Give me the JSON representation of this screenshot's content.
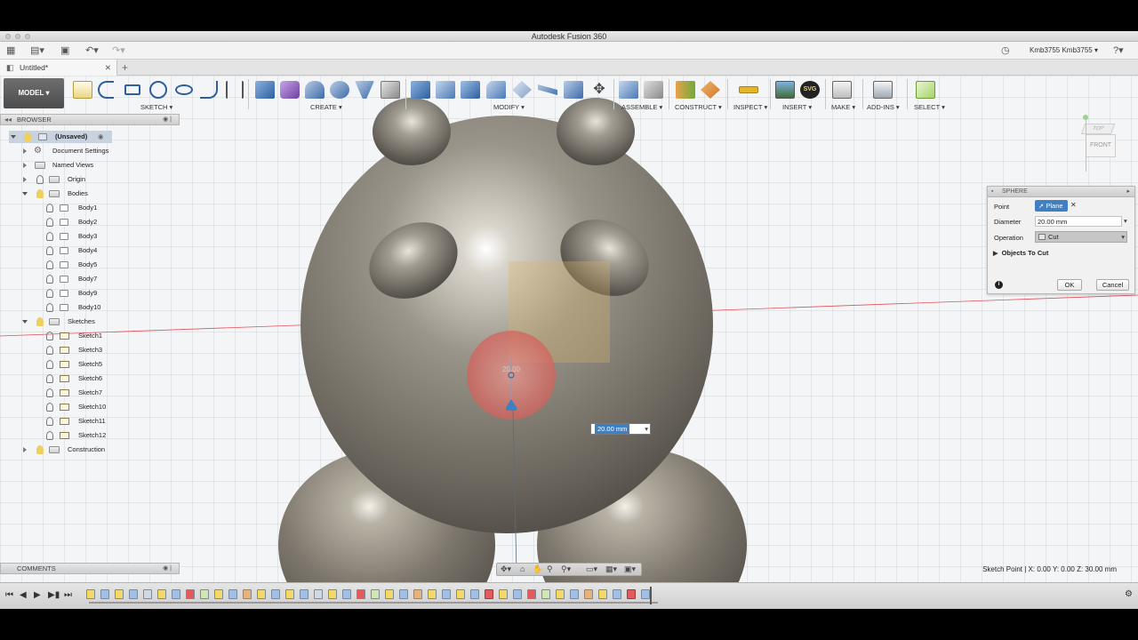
{
  "app_title": "Autodesk Fusion 360",
  "user": "Kmb3755 Kmb3755",
  "doc_tab": "Untitled*",
  "workspace": "MODEL",
  "toolbar_groups": [
    {
      "label": "SKETCH"
    },
    {
      "label": "CREATE"
    },
    {
      "label": "MODIFY"
    },
    {
      "label": "ASSEMBLE"
    },
    {
      "label": "CONSTRUCT"
    },
    {
      "label": "INSPECT"
    },
    {
      "label": "INSERT"
    },
    {
      "label": "MAKE"
    },
    {
      "label": "ADD-INS"
    },
    {
      "label": "SELECT"
    }
  ],
  "browser": {
    "title": "BROWSER",
    "root": "(Unsaved)",
    "document_settings": "Document Settings",
    "named_views": "Named Views",
    "origin": "Origin",
    "bodies_folder": "Bodies",
    "bodies": [
      "Body1",
      "Body2",
      "Body3",
      "Body4",
      "Body5",
      "Body7",
      "Body9",
      "Body10"
    ],
    "sketches_folder": "Sketches",
    "sketches": [
      "Sketch1",
      "Sketch3",
      "Sketch5",
      "Sketch6",
      "Sketch7",
      "Sketch10",
      "Sketch11",
      "Sketch12"
    ],
    "construction": "Construction"
  },
  "comments": "COMMENTS",
  "viewcube": {
    "top": "TOP",
    "front": "FRONT"
  },
  "dialog": {
    "title": "SPHERE",
    "point_label": "Point",
    "point_value": "Plane",
    "diameter_label": "Diameter",
    "diameter_value": "20.00 mm",
    "operation_label": "Operation",
    "operation_value": "Cut",
    "objects_to_cut": "Objects To Cut",
    "ok": "OK",
    "cancel": "Cancel"
  },
  "canvas": {
    "sphere_label": "20.00",
    "dimension_input": "20.00 mm"
  },
  "status_text": "Sketch Point | X: 0.00 Y: 0.00 Z: 30.00 mm",
  "colors": {
    "accent_blue": "#3f7fc4",
    "cut_red": "#e05b5b",
    "plane_tan": "#d8b26a",
    "axis_red": "#e0505a"
  }
}
